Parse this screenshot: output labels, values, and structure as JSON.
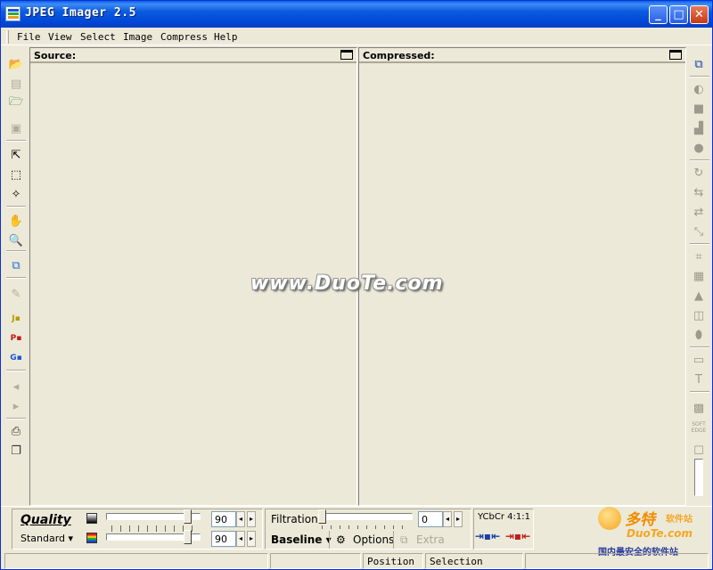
{
  "window": {
    "title": "JPEG Imager 2.5",
    "buttons": {
      "minimize": "_",
      "maximize": "□",
      "close": "✕"
    }
  },
  "menu": {
    "items": [
      {
        "label": "File"
      },
      {
        "label": "View"
      },
      {
        "label": "Select"
      },
      {
        "label": "Image"
      },
      {
        "label": "Compress"
      },
      {
        "label": "Help"
      }
    ]
  },
  "panes": {
    "source": {
      "label": "Source:"
    },
    "compressed": {
      "label": "Compressed:"
    }
  },
  "left_toolbar": {
    "icons": [
      "open-folder-icon",
      "scanner-icon",
      "open-file-icon",
      "save-icon",
      "select-arrow-icon",
      "select-freeform-icon",
      "select-magic-icon",
      "hand-icon",
      "zoom-icon",
      "copy-image-icon",
      "paint-icon",
      "jpeg-format-icon",
      "png-format-icon",
      "gif-format-icon",
      "prev-icon",
      "next-icon",
      "export-icon",
      "layers-icon"
    ]
  },
  "right_toolbar": {
    "icons": [
      "compare-icon",
      "brightness-icon",
      "levels-icon",
      "histogram-icon",
      "color-icon",
      "rotate-icon",
      "flip-icon",
      "mirror-icon",
      "resize-icon",
      "crop-icon",
      "grid-icon",
      "sharpen-icon",
      "blur-icon",
      "fill-icon",
      "shadow-icon",
      "text-icon",
      "pattern-icon",
      "soft-edge-icon",
      "checkbox-icon"
    ],
    "soft_edge_label": "SOFT EDGE"
  },
  "watermark": "www.DuoTe.com",
  "quality": {
    "label": "Quality",
    "preset": "Standard",
    "luminance_value": "90",
    "chrominance_value": "90",
    "luminance_level": 0.9,
    "chrominance_level": 0.9
  },
  "filtration": {
    "label": "Filtration",
    "value": "0",
    "level": 0.0
  },
  "encoding": {
    "mode": "Baseline",
    "options_label": "Options",
    "extra_label": "Extra"
  },
  "subsampling": {
    "label": "YCbCr 4:1:1"
  },
  "statusbar": {
    "cells": [
      "",
      "",
      "Position",
      "Selection",
      ""
    ]
  },
  "logo": {
    "cn_main": "多特",
    "cn_suffix": "软件站",
    "en": "DuoTe.com",
    "sub": "国内最安全的软件站"
  },
  "colors": {
    "titlebar": "#0a5ae0",
    "face": "#ece9d8",
    "logo_orange": "#f5a623",
    "logo_blue": "#2a3b9c"
  }
}
